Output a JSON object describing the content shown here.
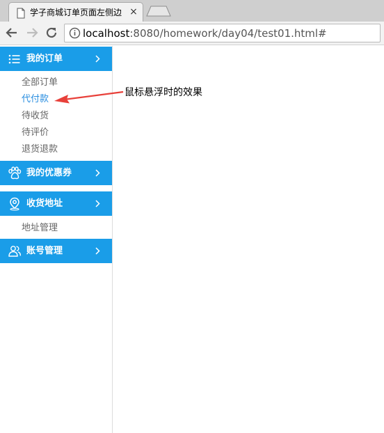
{
  "browser": {
    "tab_title": "学子商城订单页面左侧边",
    "tab_close": "×",
    "url_host": "localhost",
    "url_rest": ":8080/homework/day04/test01.html#"
  },
  "sidebar": {
    "sections": [
      {
        "label": "我的订单",
        "icon": "list-icon"
      },
      {
        "label": "我的优惠券",
        "icon": "paw-icon"
      },
      {
        "label": "收货地址",
        "icon": "location-pin-icon"
      },
      {
        "label": "账号管理",
        "icon": "users-icon"
      }
    ],
    "orders_items": [
      "全部订单",
      "代付款",
      "待收货",
      "待评价",
      "退货退款"
    ],
    "address_items": [
      "地址管理"
    ]
  },
  "annotation": {
    "text": "鼠标悬浮时的效果"
  },
  "colors": {
    "accent": "#1a9de8",
    "hover_link": "#2a8ee0",
    "sub_item_text": "#666666",
    "arrow": "#e8403a"
  }
}
